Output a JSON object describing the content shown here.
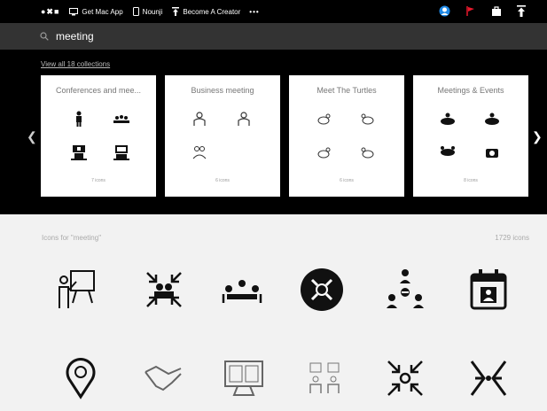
{
  "topbar": {
    "logo": "●✖■",
    "nav": [
      {
        "label": "Get Mac App"
      },
      {
        "label": "Nounji"
      },
      {
        "label": "Become A Creator"
      }
    ],
    "more": "•••",
    "right_icons": [
      "profile-icon",
      "flag-icon",
      "bag-icon",
      "upload-icon"
    ]
  },
  "search": {
    "value": "meeting",
    "placeholder": ""
  },
  "collections": {
    "view_all": "View all 18 collections",
    "cards": [
      {
        "title": "Conferences and mee...",
        "count": "7 icons"
      },
      {
        "title": "Business meeting",
        "count": "6 icons"
      },
      {
        "title": "Meet The Turtles",
        "count": "6 icons"
      },
      {
        "title": "Meetings & Events",
        "count": "8 icons"
      }
    ]
  },
  "results": {
    "title": "Icons for \"meeting\"",
    "count": "1729 icons",
    "icons": [
      "presentation-icon",
      "team-meeting-icon",
      "conference-table-icon",
      "meeting-circle-icon",
      "team-hierarchy-icon",
      "calendar-person-icon",
      "location-meeting-icon",
      "handshake-icon",
      "video-conference-icon",
      "people-icon",
      "converge-icon",
      "focus-icon"
    ]
  },
  "colors": {
    "topbar": "#000000",
    "searchbar": "#333333",
    "flag": "#e8192c",
    "profile": "#1e88e5"
  }
}
